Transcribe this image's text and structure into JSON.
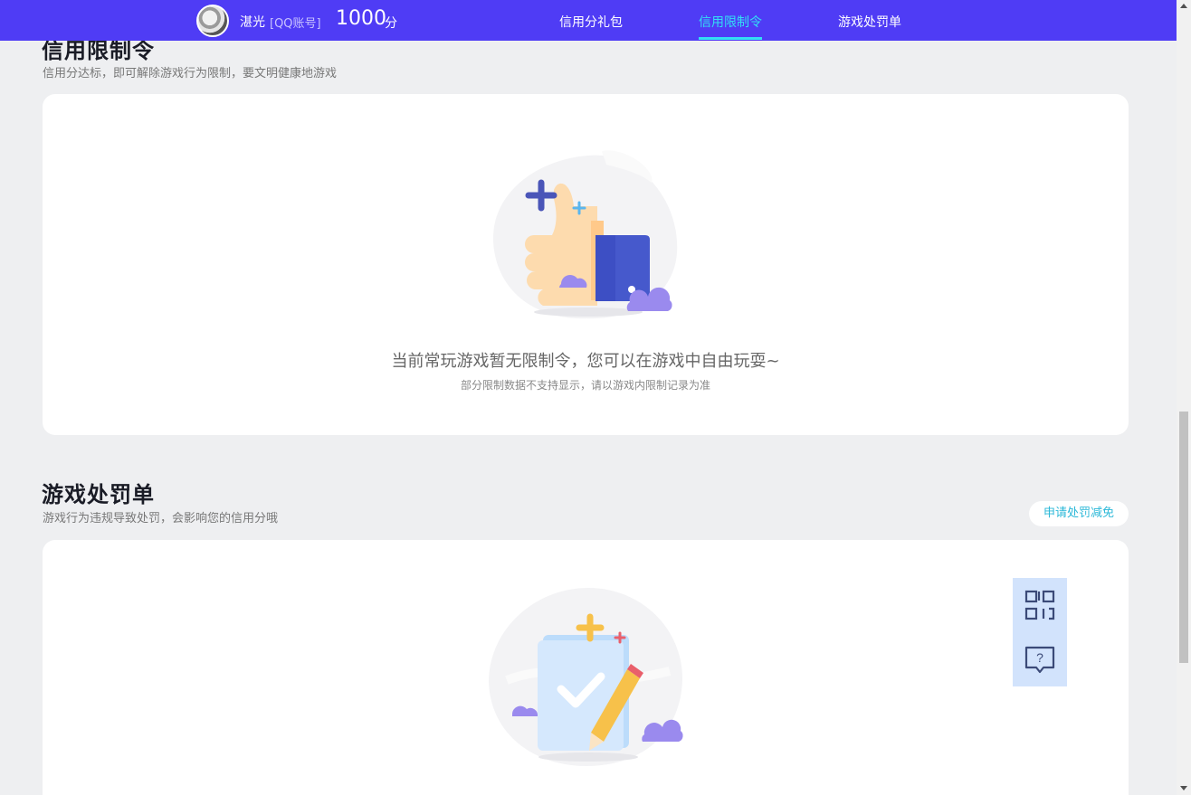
{
  "header": {
    "user_name": "湛光",
    "account_type": "[QQ账号]",
    "credit_score": "1000",
    "credit_unit": "分",
    "tabs": [
      {
        "label": "信用分礼包",
        "active": false
      },
      {
        "label": "信用限制令",
        "active": true
      },
      {
        "label": "游戏处罚单",
        "active": false
      }
    ]
  },
  "restriction": {
    "title": "信用限制令",
    "desc": "信用分达标，即可解除游戏行为限制，要文明健康地游戏",
    "empty_title": "当前常玩游戏暂无限制令，您可以在游戏中自由玩耍~",
    "empty_sub": "部分限制数据不支持显示，请以游戏内限制记录为准",
    "illustration_icon": "thumbs-up-illustration"
  },
  "penalty": {
    "title": "游戏处罚单",
    "desc": "游戏行为违规导致处罚，会影响您的信用分哦",
    "apply_button": "申请处罚减免",
    "illustration_icon": "checklist-pencil-illustration"
  },
  "float_tools": [
    {
      "icon": "qr-code-icon"
    },
    {
      "icon": "help-chat-icon"
    }
  ],
  "colors": {
    "header_bg": "#4f3cf5",
    "active_tab": "#32e0f4",
    "page_bg": "#eeeff1",
    "apply_button_text": "#2bb8d8",
    "float_tool_bg": "#d2e3fc"
  }
}
